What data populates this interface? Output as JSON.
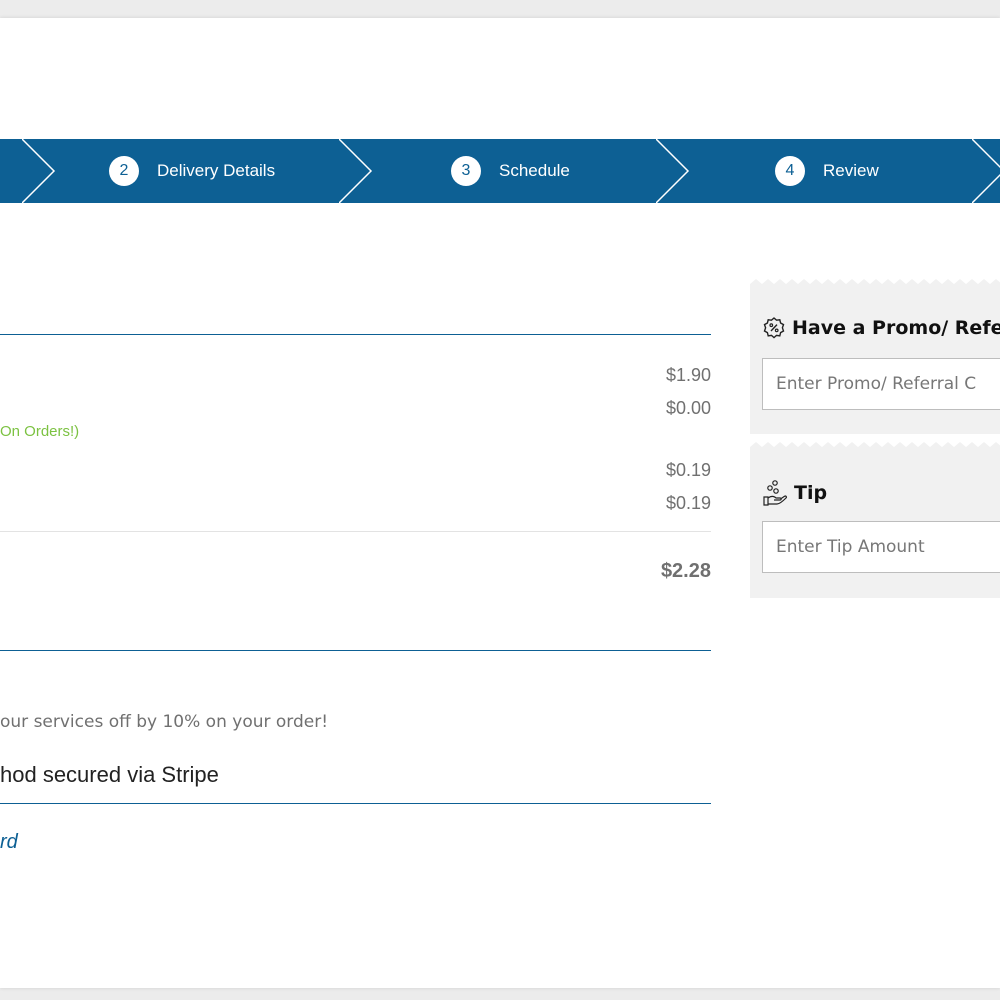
{
  "stepper": {
    "steps": [
      {
        "number": "2",
        "label": "Delivery Details"
      },
      {
        "number": "3",
        "label": "Schedule"
      },
      {
        "number": "4",
        "label": "Review"
      }
    ]
  },
  "summary": {
    "amounts": [
      "$1.90",
      "$0.00",
      "$0.19",
      "$0.19"
    ],
    "discount_note": "On Orders!)",
    "total": "$2.28"
  },
  "payment": {
    "promo_note": "our services off by 10% on your order!",
    "stripe_note": "hod secured via Stripe",
    "card_link": "rd"
  },
  "promo_panel": {
    "title": "Have a Promo/ Refer",
    "placeholder": "Enter Promo/ Referral C",
    "icon": "discount-badge-icon"
  },
  "tip_panel": {
    "title": "Tip",
    "placeholder": "Enter Tip Amount",
    "icon": "tip-hand-coins-icon"
  },
  "colors": {
    "primary": "#0d6094",
    "accent_green": "#7cc242",
    "panel_bg": "#f1f1f1"
  }
}
